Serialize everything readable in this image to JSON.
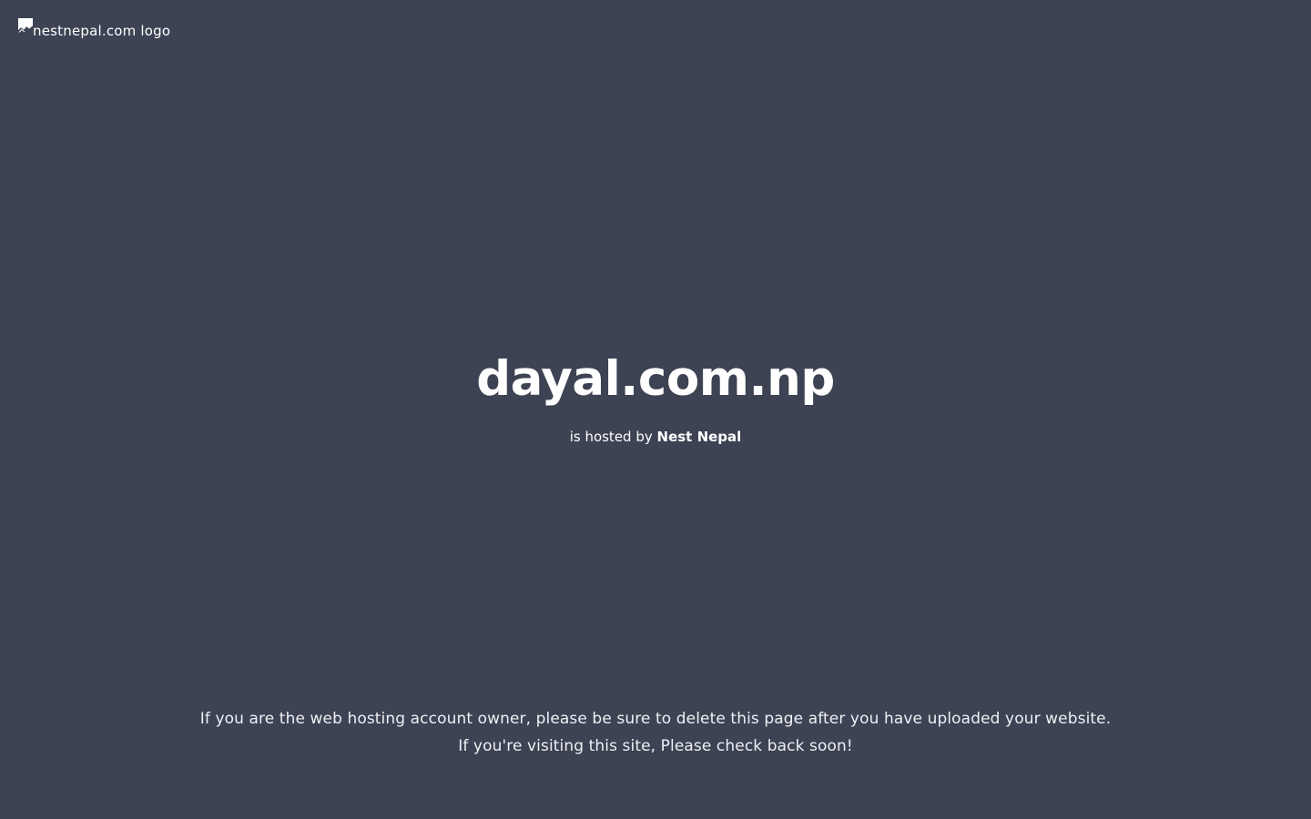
{
  "logo": {
    "alt_text": "nestnepal.com logo",
    "icon": "broken-image-icon"
  },
  "main": {
    "domain": "dayal.com.np",
    "hosted_prefix": "is hosted by ",
    "host_name": "Nest Nepal"
  },
  "footer": {
    "line1": "If you are the web hosting account owner, please be sure to delete this page after you have uploaded your website.",
    "line2": "If you're visiting this site, Please check back soon!"
  },
  "colors": {
    "background": "#3d4353",
    "text": "#ffffff"
  }
}
